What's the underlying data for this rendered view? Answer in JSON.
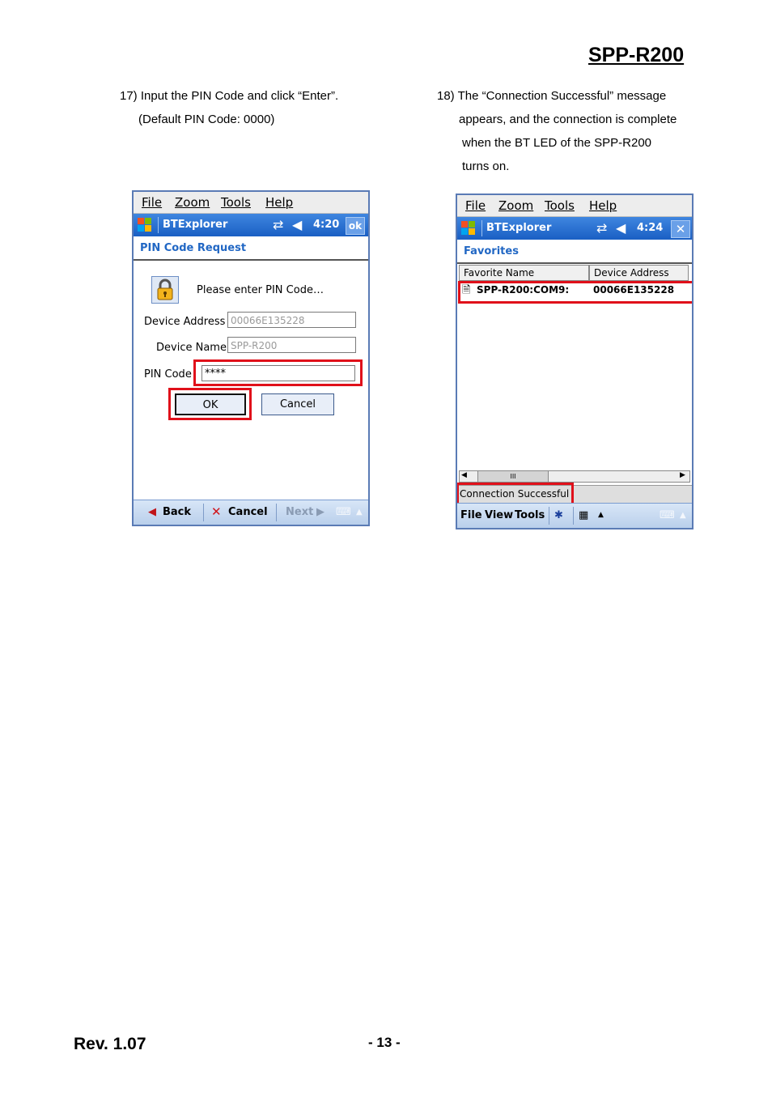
{
  "doc_title": "SPP-R200",
  "step17": {
    "line1": "17) Input the PIN Code and click “Enter”.",
    "line2": "(Default PIN Code: 0000)"
  },
  "step18": {
    "line1": "18) The “Connection Successful” message",
    "line2": "appears, and the connection is complete",
    "line3": "when the BT LED of the SPP-R200",
    "line4": "turns on."
  },
  "screen1": {
    "menu": [
      "File",
      "Zoom",
      "Tools",
      "Help"
    ],
    "app_title": "BTExplorer",
    "time": "4:20",
    "ok_label": "ok",
    "header": "PIN Code Request",
    "prompt": "Please enter PIN Code…",
    "device_address_label": "Device Address :",
    "device_address_value": "00066E135228",
    "device_name_label": "Device Name :",
    "device_name_value": "SPP-R200",
    "pin_label": "PIN Code",
    "pin_value": "****",
    "ok_button": "OK",
    "cancel_button": "Cancel",
    "back": "Back",
    "cancel": "Cancel",
    "next": "Next"
  },
  "screen2": {
    "menu": [
      "File",
      "Zoom",
      "Tools",
      "Help"
    ],
    "app_title": "BTExplorer",
    "time": "4:24",
    "header": "Favorites",
    "col_name": "Favorite Name",
    "col_address": "Device Address",
    "row_name": "SPP-R200:COM9:",
    "row_address": "00066E135228",
    "scroll_mid": "III",
    "status": "Connection Successful",
    "bottom_menu": [
      "File",
      "View",
      "Tools"
    ]
  },
  "footer": {
    "revision": "Rev. 1.07",
    "page": "- 13 -"
  },
  "colors": {
    "highlight_red": "#e0101a",
    "title_blue": "#1a5fc4",
    "header_text_blue": "#2167c4"
  }
}
